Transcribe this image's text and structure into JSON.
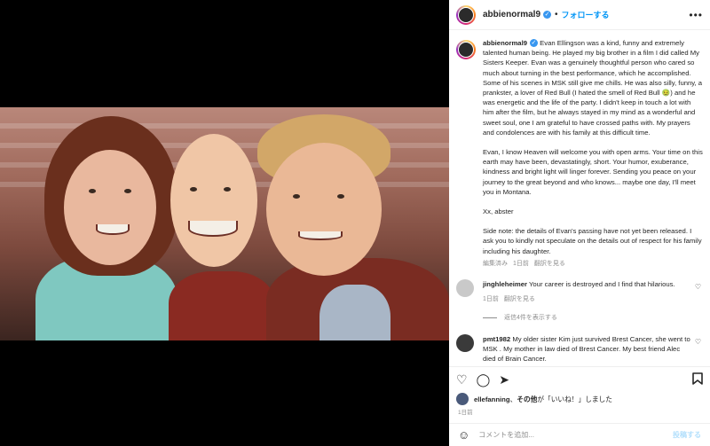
{
  "post": {
    "username": "abbienormal9",
    "verified_mark": "✓",
    "follow_label": "フォローする",
    "more_label": "•••"
  },
  "caption": {
    "username": "abbienormal9",
    "paragraphs": [
      "Evan Ellingson was a kind, funny and extremely talented human being. He played my big brother in a film I did called My Sisters Keeper. Evan was a genuinely thoughtful person who cared so much about turning in the best performance, which he accomplished. Some of his scenes in MSK still give me chills. He was also silly, funny, a prankster, a lover of Red Bull (I hated the smell of Red Bull 🤢) and he was energetic and the life of the party. I didn't keep in touch a lot with him after the film, but he always stayed in my mind as a wonderful and sweet soul, one I am grateful to have crossed paths with. My prayers and condolences are with his family at this difficult time.",
      "Evan, I know Heaven will welcome you with open arms. Your time on this earth may have been, devastatingly, short. Your humor, exuberance, kindness and bright light will linger forever. Sending you peace on your journey to the great beyond and who knows... maybe one day, I'll meet you in Montana.",
      "Xx, abster",
      "Side note: the details of Evan's passing have not yet been released. I ask you to kindly not speculate on the details out of respect for his family including his daughter."
    ],
    "edited_label": "編集済み",
    "time": "1日前",
    "translate_label": "翻訳を見る"
  },
  "comments": [
    {
      "username": "jinghleheimer",
      "text": "Your career is destroyed and I find that hilarious.",
      "time": "1日前",
      "translate_label": "翻訳を見る",
      "replies_label": "返信4件を表示する",
      "avatar_color": "#c9c9c9"
    },
    {
      "username": "pmt1982",
      "text": "My older sister Kim just survived Brest Cancer, she went to MSK . My mother in law died of Brest Cancer. My best friend Alec died of Brain Cancer.",
      "avatar_color": "#3a3a3a"
    }
  ],
  "actions": {
    "heart_icon": "♡",
    "comment_icon": "◯",
    "share_icon": "➤",
    "bookmark_icon": "🔖"
  },
  "likes": {
    "user": "ellefanning",
    "middle": "、",
    "others": "その他",
    "suffix": "が「いいね！」しました"
  },
  "date": "1日前",
  "composer": {
    "emoji_icon": "☺",
    "placeholder": "コメントを追加...",
    "post_label": "投稿する"
  },
  "colors": {
    "accent": "#0095f6",
    "verified": "#3897f0",
    "post_disabled": "#b2dffc"
  }
}
